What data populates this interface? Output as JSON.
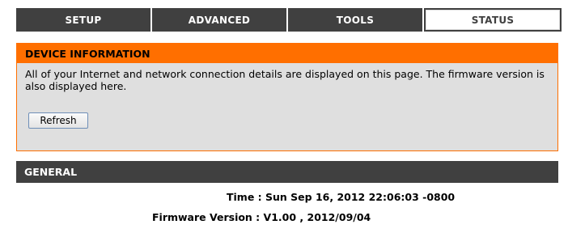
{
  "tabs": [
    {
      "label": "SETUP"
    },
    {
      "label": "ADVANCED"
    },
    {
      "label": "TOOLS"
    },
    {
      "label": "STATUS",
      "active": true
    }
  ],
  "device_info": {
    "title": "DEVICE INFORMATION",
    "description": "All of your Internet and network connection details are displayed on this page. The firmware version is also displayed here.",
    "refresh_label": "Refresh"
  },
  "general": {
    "title": "GENERAL",
    "time_label": "Time :",
    "time_value": "Sun Sep 16, 2012 22:06:03 -0800",
    "firmware_label": "Firmware Version :",
    "firmware_value": "V1.00 , 2012/09/04"
  },
  "colors": {
    "accent": "#ff6f00",
    "dark": "#404040",
    "panel_bg": "#dfdfdf"
  }
}
